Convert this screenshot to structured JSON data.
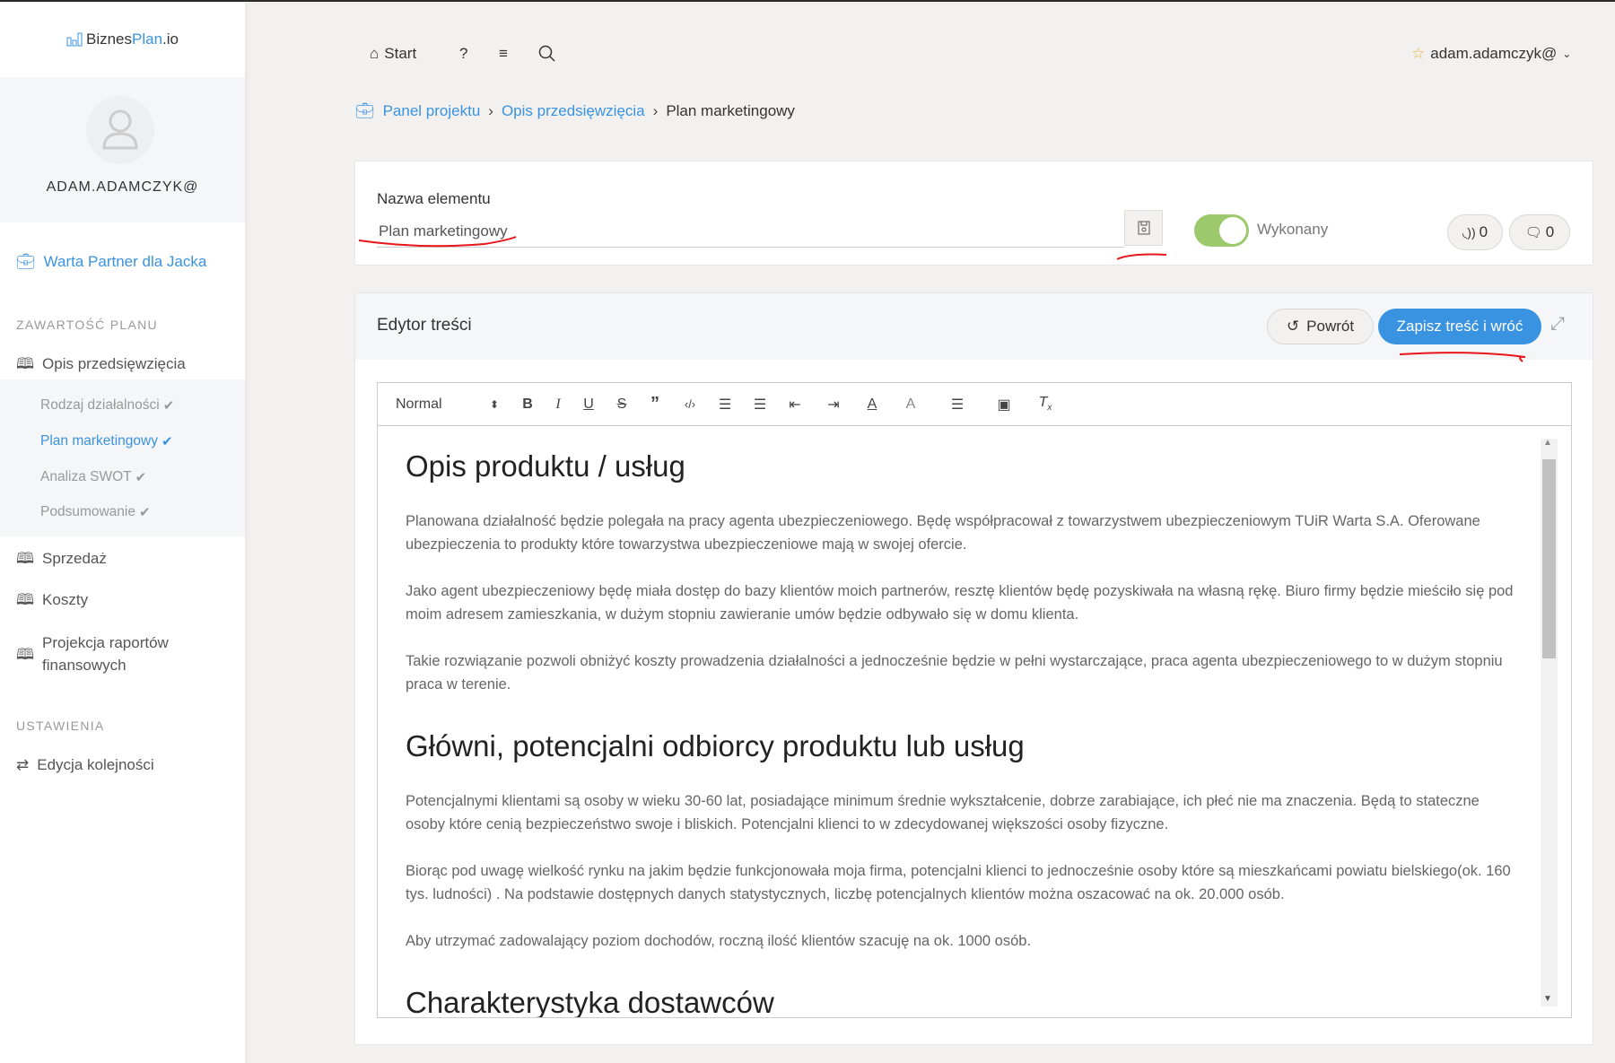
{
  "app": {
    "logo_prefix": "Biznes",
    "logo_accent": "Plan",
    "logo_suffix": ".io"
  },
  "sidebar": {
    "username": "ADAM.ADAMCZYK@",
    "project": "Warta Partner dla Jacka",
    "section_plan": "ZAWARTOŚĆ PLANU",
    "items": [
      {
        "label": "Opis przedsięwzięcia"
      },
      {
        "label": "Sprzedaż"
      },
      {
        "label": "Koszty"
      },
      {
        "label": "Projekcja raportów finansowych"
      }
    ],
    "subitems": [
      {
        "label": "Rodzaj działalności",
        "done": true
      },
      {
        "label": "Plan marketingowy",
        "done": true,
        "active": true
      },
      {
        "label": "Analiza SWOT",
        "done": true
      },
      {
        "label": "Podsumowanie",
        "done": true
      }
    ],
    "section_settings": "USTAWIENIA",
    "settings_item": "Edycja kolejności"
  },
  "topbar": {
    "start": "Start",
    "user": "adam.adamczyk@"
  },
  "breadcrumb": [
    "Panel projektu",
    "Opis przedsięwzięcia",
    "Plan marketingowy"
  ],
  "element": {
    "label": "Nazwa elementu",
    "value": "Plan marketingowy",
    "status_label": "Wykonany",
    "status_on": true,
    "feed_count": "0",
    "comments_count": "0"
  },
  "editor": {
    "title": "Edytor treści",
    "back": "Powrót",
    "save": "Zapisz treść i wróć",
    "format": "Normal",
    "content": [
      {
        "type": "h",
        "text": "Opis produktu / usług"
      },
      {
        "type": "p",
        "text": "Planowana działalność będzie polegała na pracy agenta ubezpieczeniowego. Będę współpracował z towarzystwem ubezpieczeniowym TUiR Warta S.A. Oferowane ubezpieczenia to produkty które towarzystwa ubezpieczeniowe mają w swojej ofercie."
      },
      {
        "type": "p",
        "text": "Jako agent ubezpieczeniowy będę miała dostęp do bazy klientów moich partnerów, resztę klientów będę pozyskiwała na własną rękę. Biuro firmy będzie mieściło się pod moim adresem zamieszkania, w dużym stopniu zawieranie umów będzie odbywało się w domu klienta."
      },
      {
        "type": "p",
        "text": "Takie rozwiązanie pozwoli obniżyć koszty prowadzenia działalności a jednocześnie będzie w pełni wystarczające, praca agenta ubezpieczeniowego to w dużym stopniu praca w terenie."
      },
      {
        "type": "h",
        "text": "Główni, potencjalni odbiorcy produktu lub usług"
      },
      {
        "type": "p",
        "text": "Potencjalnymi klientami są osoby w wieku 30-60 lat, posiadające minimum średnie wykształcenie, dobrze zarabiające, ich płeć nie ma znaczenia. Będą to stateczne osoby które cenią bezpieczeństwo swoje i bliskich. Potencjalni klienci to w zdecydowanej większości osoby fizyczne."
      },
      {
        "type": "p",
        "text": "Biorąc pod uwagę wielkość rynku na jakim będzie funkcjonowała moja firma, potencjalni klienci to jednocześnie osoby które są mieszkańcami powiatu bielskiego(ok. 160 tys. ludności) . Na podstawie dostępnych danych statystycznych, liczbę potencjalnych klientów można oszacować na ok. 20.000 osób."
      },
      {
        "type": "p",
        "text": "Aby utrzymać zadowalający poziom dochodów, roczną ilość klientów szacuję na ok. 1000 osób."
      },
      {
        "type": "h",
        "text": "Charakterystyka dostawców"
      }
    ]
  },
  "colors": {
    "accent": "#3a93e0",
    "toggle": "#9bc96b",
    "annotation": "#e8151b"
  }
}
